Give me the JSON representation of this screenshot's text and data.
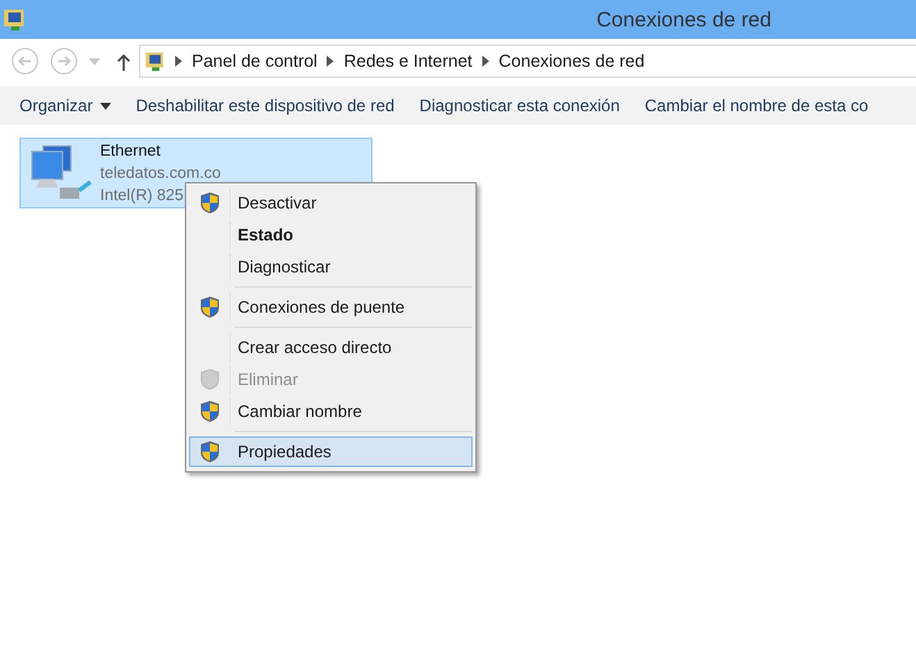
{
  "window": {
    "title": "Conexiones de red"
  },
  "address_bar": {
    "breadcrumbs": [
      "Panel de control",
      "Redes e Internet",
      "Conexiones de red"
    ]
  },
  "command_bar": [
    {
      "label": "Organizar",
      "dropdown": true
    },
    {
      "label": "Deshabilitar este dispositivo de red",
      "dropdown": false
    },
    {
      "label": "Diagnosticar esta conexión",
      "dropdown": false
    },
    {
      "label": "Cambiar el nombre de esta co",
      "dropdown": false
    }
  ],
  "connections": [
    {
      "name": "Ethernet",
      "network": "teledatos.com.co",
      "adapter": "Intel(R) 825",
      "selected": true
    }
  ],
  "context_menu": {
    "items": [
      {
        "kind": "item",
        "label": "Desactivar",
        "shield": true,
        "bold": false,
        "disabled": false,
        "selected": false
      },
      {
        "kind": "item",
        "label": "Estado",
        "shield": false,
        "bold": true,
        "disabled": false,
        "selected": false
      },
      {
        "kind": "item",
        "label": "Diagnosticar",
        "shield": false,
        "bold": false,
        "disabled": false,
        "selected": false
      },
      {
        "kind": "separator"
      },
      {
        "kind": "item",
        "label": "Conexiones de puente",
        "shield": true,
        "bold": false,
        "disabled": false,
        "selected": false
      },
      {
        "kind": "separator"
      },
      {
        "kind": "item",
        "label": "Crear acceso directo",
        "shield": false,
        "bold": false,
        "disabled": false,
        "selected": false
      },
      {
        "kind": "item",
        "label": "Eliminar",
        "shield": true,
        "bold": false,
        "disabled": true,
        "selected": false
      },
      {
        "kind": "item",
        "label": "Cambiar nombre",
        "shield": true,
        "bold": false,
        "disabled": false,
        "selected": false
      },
      {
        "kind": "separator"
      },
      {
        "kind": "item",
        "label": "Propiedades",
        "shield": true,
        "bold": false,
        "disabled": false,
        "selected": true
      }
    ]
  }
}
